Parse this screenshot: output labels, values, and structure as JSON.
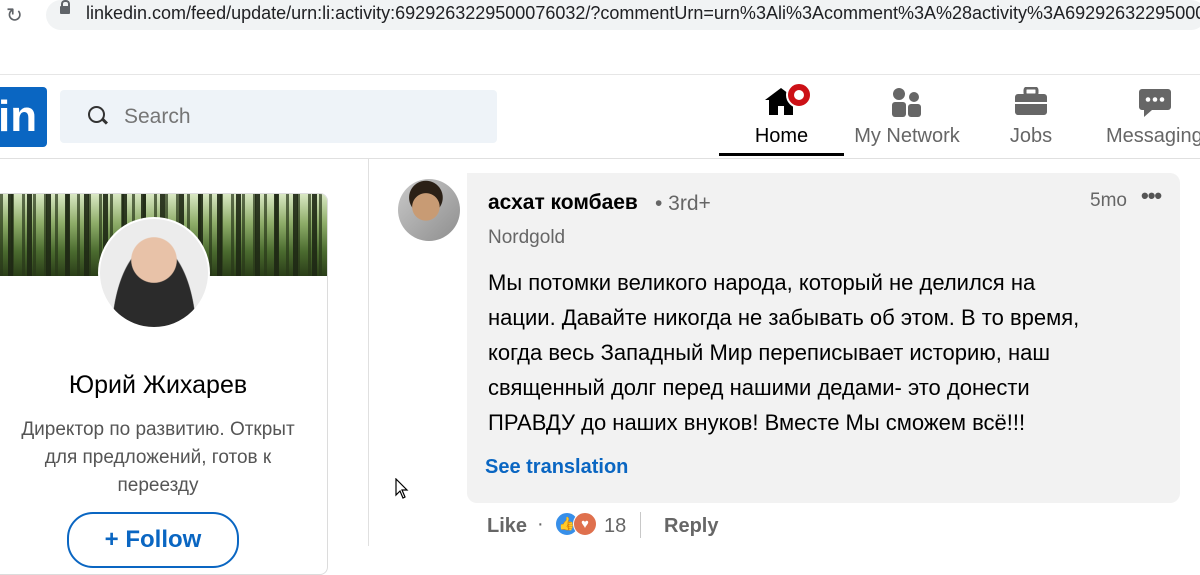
{
  "browser": {
    "url": "linkedin.com/feed/update/urn:li:activity:6929263229500076032/?commentUrn=urn%3Ali%3Acomment%3A%28activity%3A692926322950007603",
    "reload_icon": "reload-icon",
    "lock_icon": "lock-icon"
  },
  "nav": {
    "logo": "in",
    "search_placeholder": "Search",
    "items": [
      {
        "label": "Home",
        "icon": "home-icon",
        "active": true
      },
      {
        "label": "My Network",
        "icon": "network-icon"
      },
      {
        "label": "Jobs",
        "icon": "briefcase-icon"
      },
      {
        "label": "Messaging",
        "icon": "messaging-icon"
      }
    ]
  },
  "profile": {
    "name": "Юрий Жихарев",
    "headline_lines": [
      "Директор по развитию. Открыт",
      "для предложений, готов к",
      "переезду"
    ],
    "follow_label": "+ Follow"
  },
  "comment": {
    "author": "асхат комбаев",
    "degree": "• 3rd+",
    "company": "Nordgold",
    "time": "5mo",
    "more": "•••",
    "text_lines": [
      "Мы потомки великого народа, который не делился на",
      "нации. Давайте никогда не забывать об этом. В то время,",
      "когда весь Западный Мир переписывает историю, наш",
      "священный долг перед нашими дедами- это донести",
      "ПРАВДУ до наших внуков! Вместе Мы сможем всё!!!"
    ],
    "see_translation": "See translation",
    "actions": {
      "like": "Like",
      "dot": "·",
      "reaction_count": "18",
      "reply": "Reply"
    }
  },
  "colors": {
    "brand": "#0a66c2",
    "badge": "#cc1016",
    "bubble": "#f2f2f2"
  }
}
